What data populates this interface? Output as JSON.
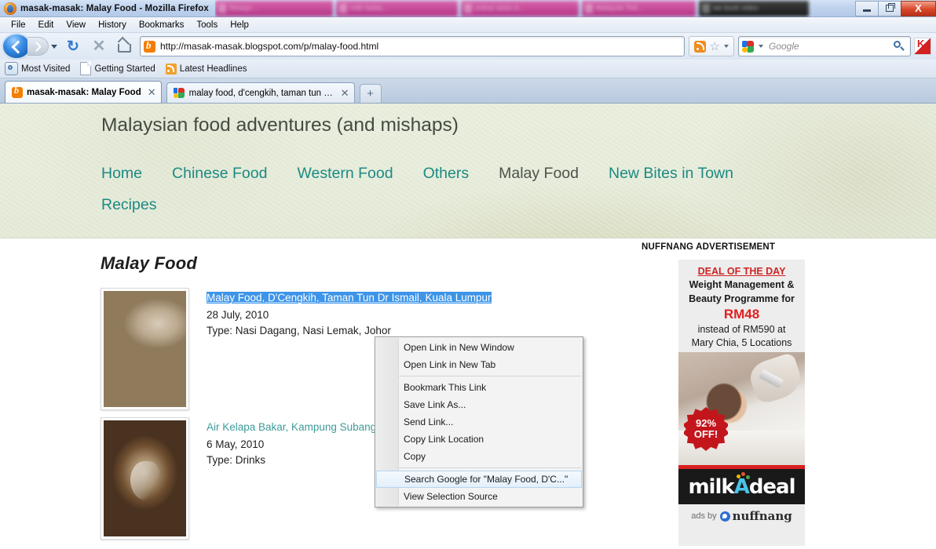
{
  "window": {
    "title": "masak-masak: Malay Food - Mozilla Firefox",
    "minimize_label": "Minimize",
    "restore_label": "Restore",
    "close_label": "X",
    "taskbar_items": [
      "Resepi...",
      "milk hadia...",
      "online news d...",
      "Malaysia Tod...",
      "we book video"
    ]
  },
  "menubar": {
    "items": [
      "File",
      "Edit",
      "View",
      "History",
      "Bookmarks",
      "Tools",
      "Help"
    ]
  },
  "toolbar": {
    "back_label": "Back",
    "forward_label": "Forward",
    "reload_glyph": "↻",
    "stop_glyph": "✕",
    "home_label": "Home",
    "url": "http://masak-masak.blogspot.com/p/malay-food.html",
    "feed_label": "Subscribe",
    "bookmark_star": "☆",
    "search_placeholder": "Google",
    "search_value": "",
    "kaspersky_label": "Kaspersky"
  },
  "bookmarks": {
    "items": [
      {
        "label": "Most Visited",
        "icon": "most-visited-icon"
      },
      {
        "label": "Getting Started",
        "icon": "page-icon"
      },
      {
        "label": "Latest Headlines",
        "icon": "rss-icon"
      }
    ]
  },
  "tabs": {
    "items": [
      {
        "title": "masak-masak: Malay Food",
        "active": true,
        "favicon": "blogger-icon",
        "close": "✕"
      },
      {
        "title": "malay food, d'cengkih, taman tun d...",
        "active": false,
        "favicon": "google-icon",
        "close": "✕"
      }
    ],
    "new_tab_glyph": "+"
  },
  "blog": {
    "header_title": "Malaysian food adventures (and mishaps)",
    "nav": [
      {
        "label": "Home",
        "current": false
      },
      {
        "label": "Chinese Food",
        "current": false
      },
      {
        "label": "Western Food",
        "current": false
      },
      {
        "label": "Others",
        "current": false
      },
      {
        "label": "Malay Food",
        "current": true
      },
      {
        "label": "New Bites in Town",
        "current": false
      },
      {
        "label": "Recipes",
        "current": false
      }
    ],
    "page_heading": "Malay Food",
    "posts": [
      {
        "title": "Malay Food, D'Cengkih, Taman Tun Dr Ismail, Kuala Lumpur",
        "date": "28 July, 2010",
        "type": "Type: Nasi Dagang, Nasi Lemak, Johor",
        "selected": true,
        "thumb": "nasi-dagang-photo"
      },
      {
        "title": "Air Kelapa Bakar, Kampung Subang, Selangor",
        "date": "6 May, 2010",
        "type": "Type: Drinks",
        "selected": false,
        "thumb": "air-kelapa-bakar-photo"
      }
    ]
  },
  "sidebar": {
    "ad_label": "NUFFNANG ADVERTISEMENT",
    "ad": {
      "deal_of_the_day": "DEAL OF THE DAY",
      "headline_line1": "Weight Management &",
      "headline_line2": "Beauty Programme for",
      "price": "RM48",
      "sub_line1": "instead of RM590 at",
      "sub_line2": "Mary Chia, 5 Locations",
      "badge_line1": "92%",
      "badge_line2": "OFF!",
      "brand_prefix": "milk",
      "brand_accent": "A",
      "brand_suffix": "deal",
      "ads_by": "ads by",
      "ads_by_brand": "nuffnang"
    }
  },
  "context_menu": {
    "items": [
      {
        "label": "Open Link in New Window",
        "accel": "W",
        "highlight": false,
        "separator_after": false
      },
      {
        "label": "Open Link in New Tab",
        "accel": "T",
        "highlight": false,
        "separator_after": true
      },
      {
        "label": "Bookmark This Link",
        "accel": "L",
        "highlight": false,
        "separator_after": false
      },
      {
        "label": "Save Link As...",
        "accel": "k",
        "highlight": false,
        "separator_after": false
      },
      {
        "label": "Send Link...",
        "accel": "d",
        "highlight": false,
        "separator_after": false
      },
      {
        "label": "Copy Link Location",
        "accel": "a",
        "highlight": false,
        "separator_after": false
      },
      {
        "label": "Copy",
        "accel": "C",
        "highlight": false,
        "separator_after": true
      },
      {
        "label": "Search Google for \"Malay Food, D'C...\"",
        "accel": "S",
        "highlight": true,
        "separator_after": false
      },
      {
        "label": "View Selection Source",
        "accel": "e",
        "highlight": false,
        "separator_after": false
      }
    ]
  },
  "colors": {
    "link_teal": "#3f9a9a",
    "nav_teal": "#1b8a84",
    "selection_blue": "#3d94e8",
    "ad_red": "#e02020",
    "banner_cream": "#e6ecda"
  }
}
